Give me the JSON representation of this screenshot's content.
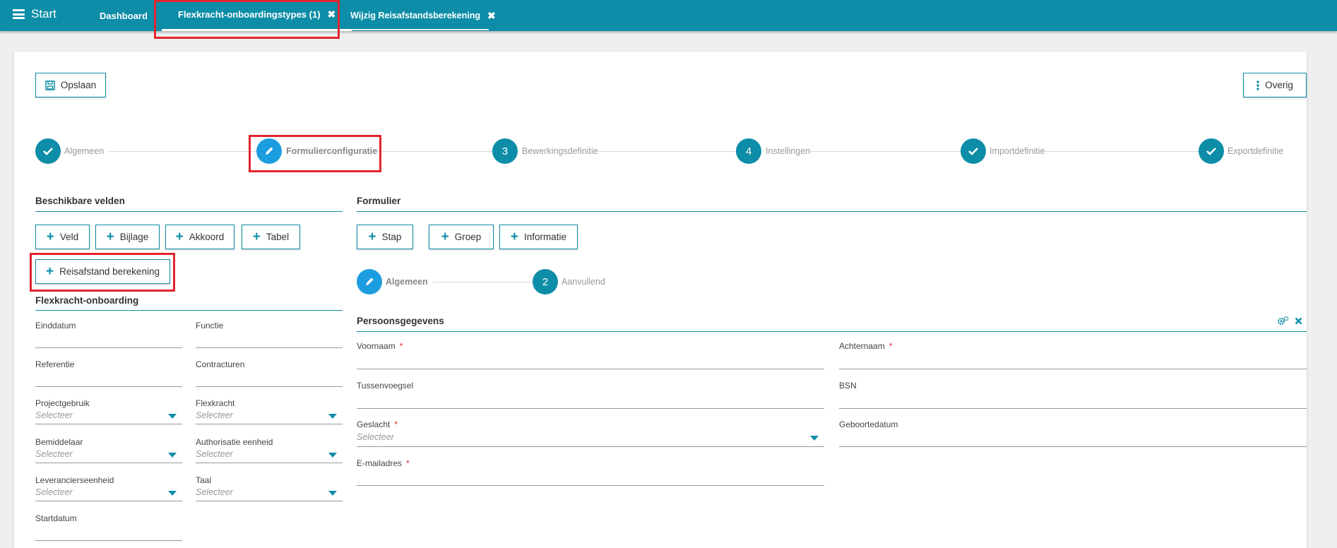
{
  "topbar": {
    "start_label": "Start",
    "tabs": [
      {
        "label": "Dashboard"
      },
      {
        "label": "Flexkracht-onboardingstypes (1)",
        "close": "✖"
      },
      {
        "label": "Wijzig Reisafstandsberekening",
        "close": "✖"
      }
    ]
  },
  "toolbar": {
    "save_label": "Opslaan",
    "more_label": "Overig"
  },
  "stepper": [
    {
      "label": "Algemeen",
      "state": "done"
    },
    {
      "label": "Formulierconfiguratie",
      "state": "edit"
    },
    {
      "label": "Bewerkingsdefinitie",
      "number": "3"
    },
    {
      "label": "Instellingen",
      "number": "4"
    },
    {
      "label": "Importdefinitie",
      "state": "done"
    },
    {
      "label": "Exportdefinitie",
      "state": "done"
    }
  ],
  "available": {
    "title": "Beschikbare velden",
    "buttons": [
      "Veld",
      "Bijlage",
      "Akkoord",
      "Tabel",
      "Reisafstand berekening"
    ],
    "group_title": "Flexkracht-onboarding",
    "select_placeholder": "Selecteer",
    "fields": [
      {
        "label": "Einddatum"
      },
      {
        "label": "Functie"
      },
      {
        "label": "Referentie"
      },
      {
        "label": "Contracturen"
      },
      {
        "label": "Projectgebruik",
        "select": true
      },
      {
        "label": "Flexkracht",
        "select": true
      },
      {
        "label": "Bemiddelaar",
        "select": true
      },
      {
        "label": "Authorisatie eenheid",
        "select": true
      },
      {
        "label": "Leverancierseenheid",
        "select": true
      },
      {
        "label": "Taal",
        "select": true
      },
      {
        "label": "Startdatum"
      }
    ]
  },
  "form": {
    "title": "Formulier",
    "buttons": [
      "Stap",
      "Groep",
      "Informatie"
    ],
    "substeps": [
      {
        "label": "Algemeen",
        "state": "edit"
      },
      {
        "label": "Aanvullend",
        "number": "2"
      }
    ],
    "section_title": "Persoonsgegevens",
    "required_mark": "*",
    "select_placeholder": "Selecteer",
    "fields": [
      {
        "label": "Voornaam",
        "required": true
      },
      {
        "label": "Achternaam",
        "required": true
      },
      {
        "label": "Tussenvoegsel"
      },
      {
        "label": "BSN"
      },
      {
        "label": "Geslacht",
        "required": true,
        "select": true
      },
      {
        "label": "Geboortedatum"
      },
      {
        "label": "E-mailadres",
        "required": true
      }
    ]
  },
  "colors": {
    "accent": "#0d8da7",
    "edit_step": "#1c9de0",
    "highlight": "#e2252d"
  }
}
